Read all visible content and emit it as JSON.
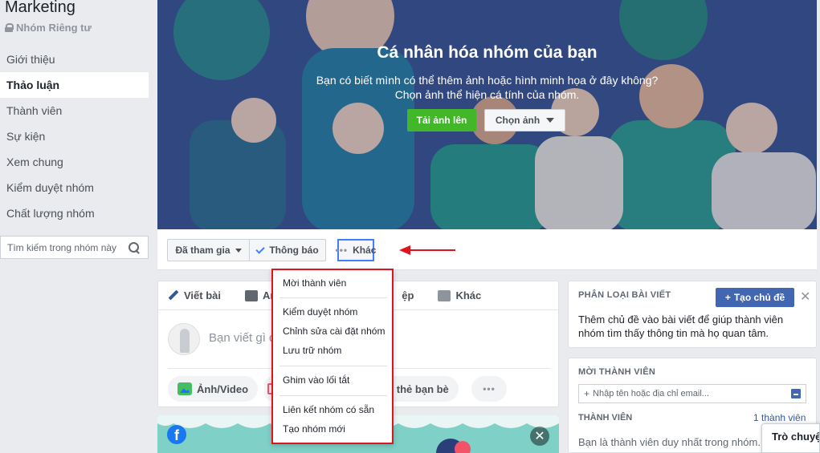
{
  "group": {
    "name": "Marketing",
    "privacy": "Nhóm Riêng tư"
  },
  "sidebar": {
    "items": [
      {
        "label": "Giới thiệu"
      },
      {
        "label": "Thảo luận"
      },
      {
        "label": "Thành viên"
      },
      {
        "label": "Sự kiện"
      },
      {
        "label": "Xem chung"
      },
      {
        "label": "Kiểm duyệt nhóm"
      },
      {
        "label": "Chất lượng nhóm"
      }
    ],
    "active_index": 1,
    "search_placeholder": "Tìm kiếm trong nhóm này"
  },
  "cover": {
    "title": "Cá nhân hóa nhóm của bạn",
    "line1": "Bạn có biết mình có thể thêm ảnh hoặc hình minh họa ở đây không?",
    "line2": "Chọn ảnh thể hiện cá tính của nhóm.",
    "upload_label": "Tải ảnh lên",
    "choose_label": "Chọn ảnh"
  },
  "actions": {
    "joined_label": "Đã tham gia",
    "notify_label": "Thông báo",
    "more_label": "Khác"
  },
  "dropdown": {
    "items": [
      "Mời thành viên",
      "Kiểm duyệt nhóm",
      "Chỉnh sửa cài đặt nhóm",
      "Lưu trữ nhóm",
      "Ghim vào lối tắt",
      "Liên kết nhóm có sẵn",
      "Tạo nhóm mới"
    ]
  },
  "composer": {
    "tab_write": "Viết bài",
    "tab_photo": "Anh",
    "tab_partial": "ệp",
    "tab_more": "Khác",
    "placeholder": "Bạn viết gì đi",
    "photo_video": "Ảnh/Video",
    "tag_friends": "ận thẻ bạn bè"
  },
  "topics": {
    "heading": "PHÂN LOẠI BÀI VIẾT",
    "create_label": "Tạo chủ đề",
    "text": "Thêm chủ đề vào bài viết để giúp thành viên nhóm tìm thấy thông tin mà họ quan tâm."
  },
  "invite": {
    "heading": "MỜI THÀNH VIÊN",
    "input_placeholder": "Nhập tên hoặc địa chỉ email...",
    "members_heading": "THÀNH VIÊN",
    "members_count": "1 thành viên",
    "members_text": "Bạn là thành viên duy nhất trong nhóm."
  },
  "chat": {
    "label": "Trò chuyện"
  },
  "colors": {
    "accent": "#4267b2",
    "green": "#42b72a",
    "highlight_red": "#e0141e",
    "cover_bg": "#3b4f8c"
  }
}
